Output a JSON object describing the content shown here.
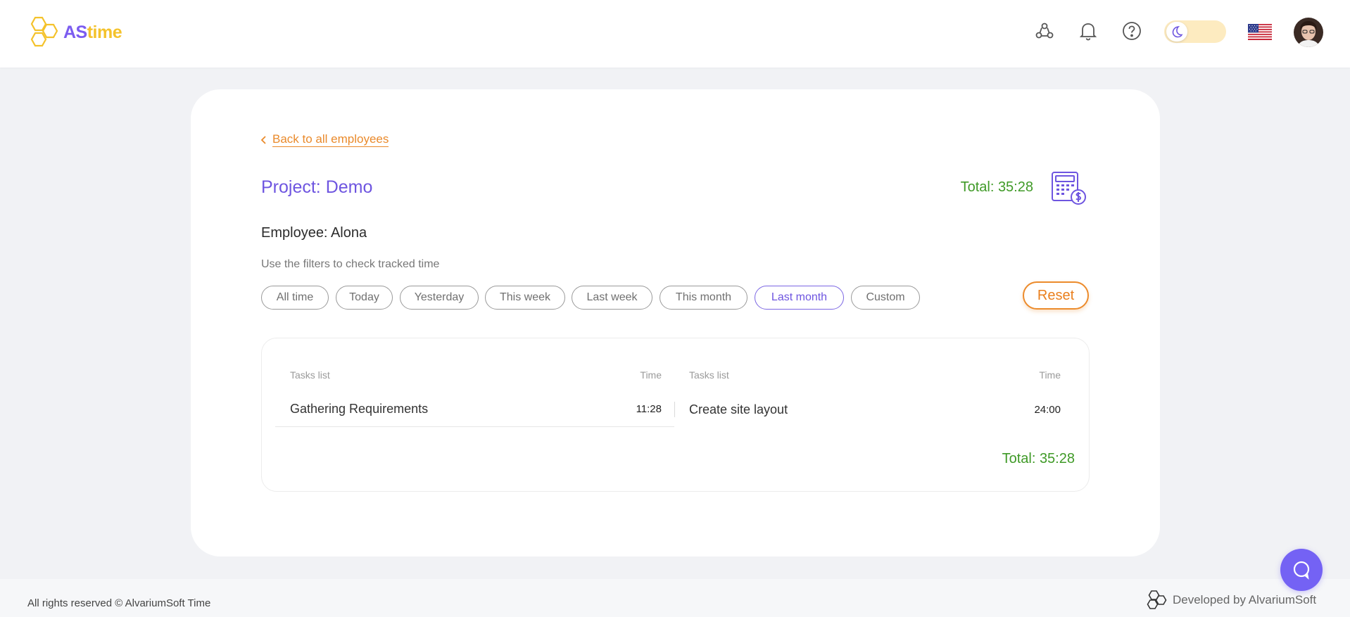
{
  "header": {
    "logo": {
      "part1": "AS",
      "part2": "time"
    },
    "icons": [
      "team-icon",
      "bell-icon",
      "help-icon"
    ],
    "theme_toggle_icon": "moon-icon",
    "language_flag": "us-flag-icon"
  },
  "content": {
    "back_link": "Back to all employees",
    "project_title": "Project: Demo",
    "total_top": "Total: 35:28",
    "employee": "Employee: Alona",
    "filter_hint": "Use the filters to check tracked time",
    "filters": [
      "All time",
      "Today",
      "Yesterday",
      "This week",
      "Last week",
      "This month",
      "Last month",
      "Custom"
    ],
    "active_filter": "Last month",
    "reset_label": "Reset"
  },
  "tasks": {
    "headers": {
      "task": "Tasks list",
      "time": "Time"
    },
    "items": [
      {
        "name": "Gathering Requirements",
        "time": "11:28"
      },
      {
        "name": "Create site layout",
        "time": "24:00"
      }
    ],
    "total": "Total: 35:28"
  },
  "footer": {
    "copyright": "All rights reserved © AlvariumSoft Time",
    "developed_by": "Developed by AlvariumSoft"
  },
  "colors": {
    "accent": "#6e55e0",
    "orange": "#ea8a2b",
    "green": "#3f9a27",
    "logo_yellow": "#f4c22b"
  }
}
